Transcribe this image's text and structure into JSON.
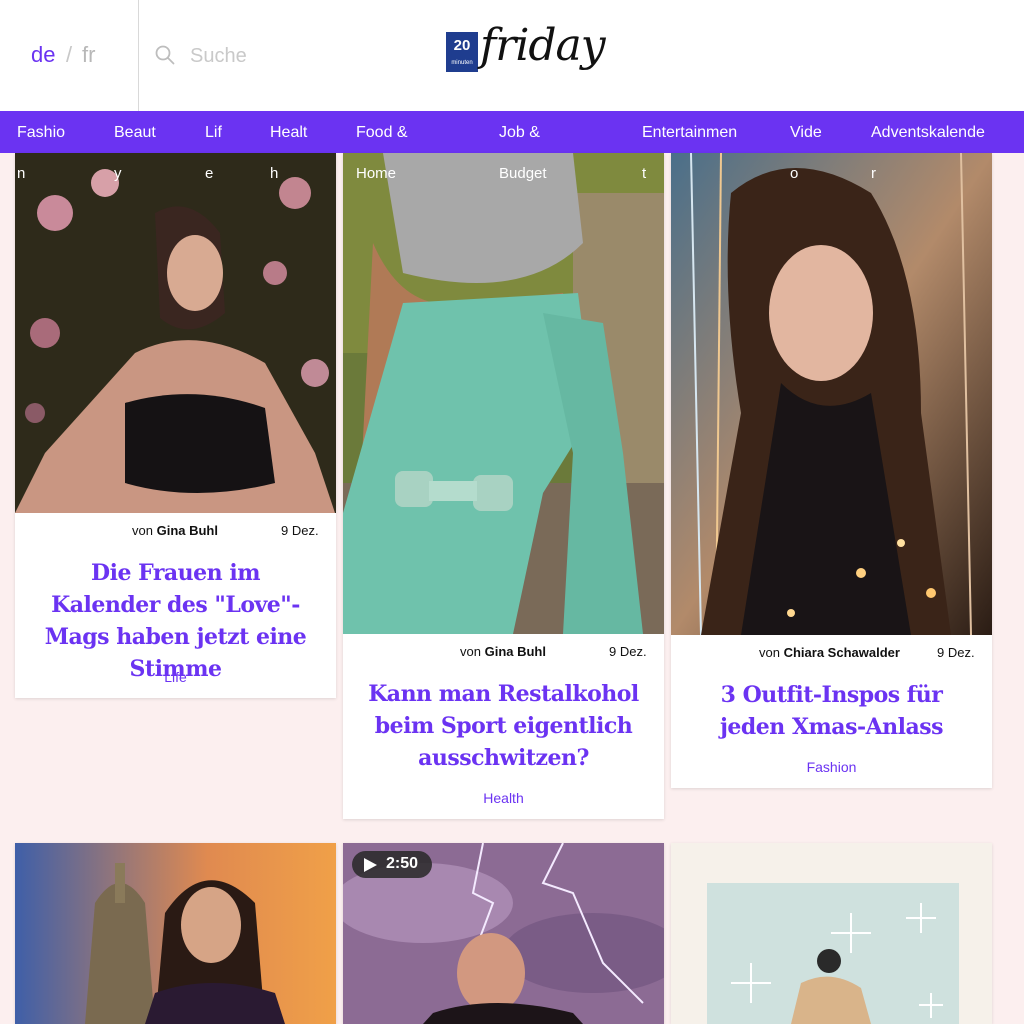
{
  "header": {
    "lang_de": "de",
    "lang_sep": "/",
    "lang_fr": "fr",
    "search_placeholder": "Suche",
    "logo_box_top": "20",
    "logo_box_sub": "minuten",
    "logo_word": "friday"
  },
  "nav": {
    "items": [
      {
        "label": "Fashio",
        "wrap": "n"
      },
      {
        "label": "Beaut",
        "wrap": "y"
      },
      {
        "label": "Lif",
        "wrap": "e"
      },
      {
        "label": "Healt",
        "wrap": "h"
      },
      {
        "label": "Food &",
        "wrap": "Home"
      },
      {
        "label": "Job &",
        "wrap": "Budget"
      },
      {
        "label": "Entertainmen",
        "wrap": "t"
      },
      {
        "label": "Vide",
        "wrap": "o"
      },
      {
        "label": "Adventskalende",
        "wrap": "r"
      }
    ]
  },
  "articles": [
    {
      "author_prefix": "von",
      "author": "Gina Buhl",
      "date": "9 Dez.",
      "title": "Die Frauen im Kalender des \"Love\"-Mags haben jetzt eine Stimme",
      "category": "Life",
      "image": "woman-latex-outfit-flowers"
    },
    {
      "author_prefix": "von",
      "author": "Gina Buhl",
      "date": "9 Dez.",
      "title": "Kann man Restalkohol beim Sport eigentlich ausschwitzen?",
      "category": "Health",
      "image": "woman-workout-dumbbell"
    },
    {
      "author_prefix": "von",
      "author": "Chiara Schawalder",
      "date": "9 Dez.",
      "title": "3 Outfit-Inspos für jeden Xmas-Anlass",
      "category": "Fashion",
      "image": "woman-tinsel-portrait"
    },
    {
      "image": "tv-presenter-city"
    },
    {
      "image": "man-lightning-sky",
      "video_duration": "2:50"
    },
    {
      "image": "winter-illustration-snowflakes"
    }
  ],
  "colors": {
    "accent": "#6b33f2",
    "logo_blue": "#1f3d8f",
    "background": "#fcefef"
  }
}
